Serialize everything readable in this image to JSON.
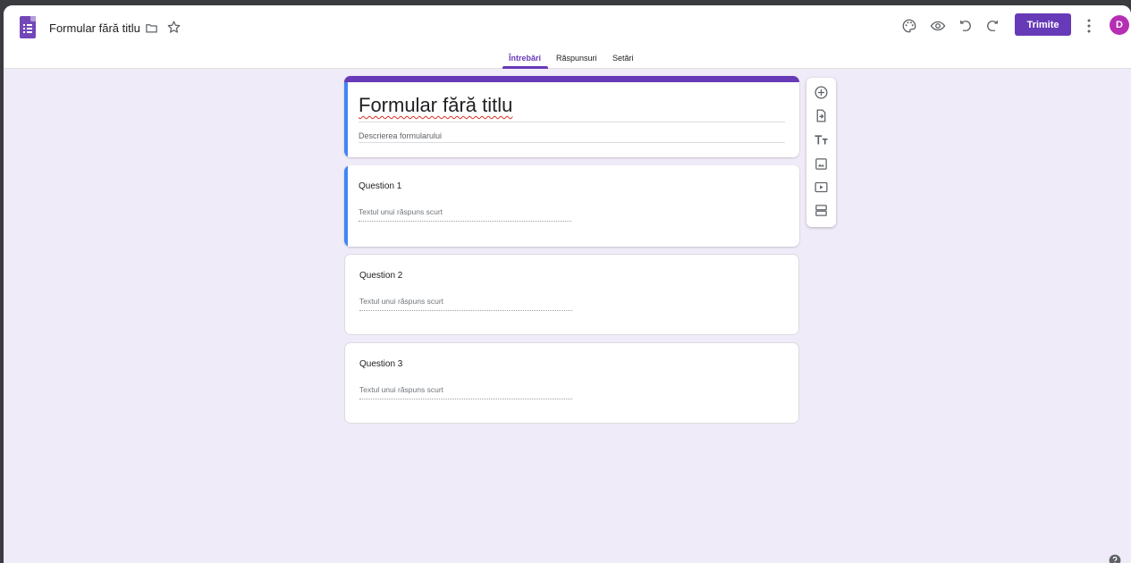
{
  "header": {
    "doc_title": "Formular fără titlu",
    "send_label": "Trimite",
    "avatar_initial": "D"
  },
  "tabs": [
    {
      "label": "Întrebări",
      "active": true
    },
    {
      "label": "Răspunsuri",
      "active": false
    },
    {
      "label": "Setări",
      "active": false
    }
  ],
  "form": {
    "title": "Formular fără titlu",
    "description_placeholder": "Descrierea formularului"
  },
  "questions": [
    {
      "title": "Question 1",
      "answer_placeholder": "Textul unui răspuns scurt",
      "active": true
    },
    {
      "title": "Question 2",
      "answer_placeholder": "Textul unui răspuns scurt",
      "active": false
    },
    {
      "title": "Question 3",
      "answer_placeholder": "Textul unui răspuns scurt",
      "active": false
    }
  ],
  "toolbar_icons": [
    "add-question-icon",
    "import-questions-icon",
    "add-title-icon",
    "add-image-icon",
    "add-video-icon",
    "add-section-icon"
  ],
  "header_icons": [
    "palette-icon",
    "preview-eye-icon",
    "undo-icon",
    "redo-icon",
    "more-vert-icon"
  ],
  "colors": {
    "accent": "#673ab7",
    "active_card_stripe": "#4285f4",
    "page_background": "#f0ebf8",
    "avatar": "#b52eb4"
  }
}
